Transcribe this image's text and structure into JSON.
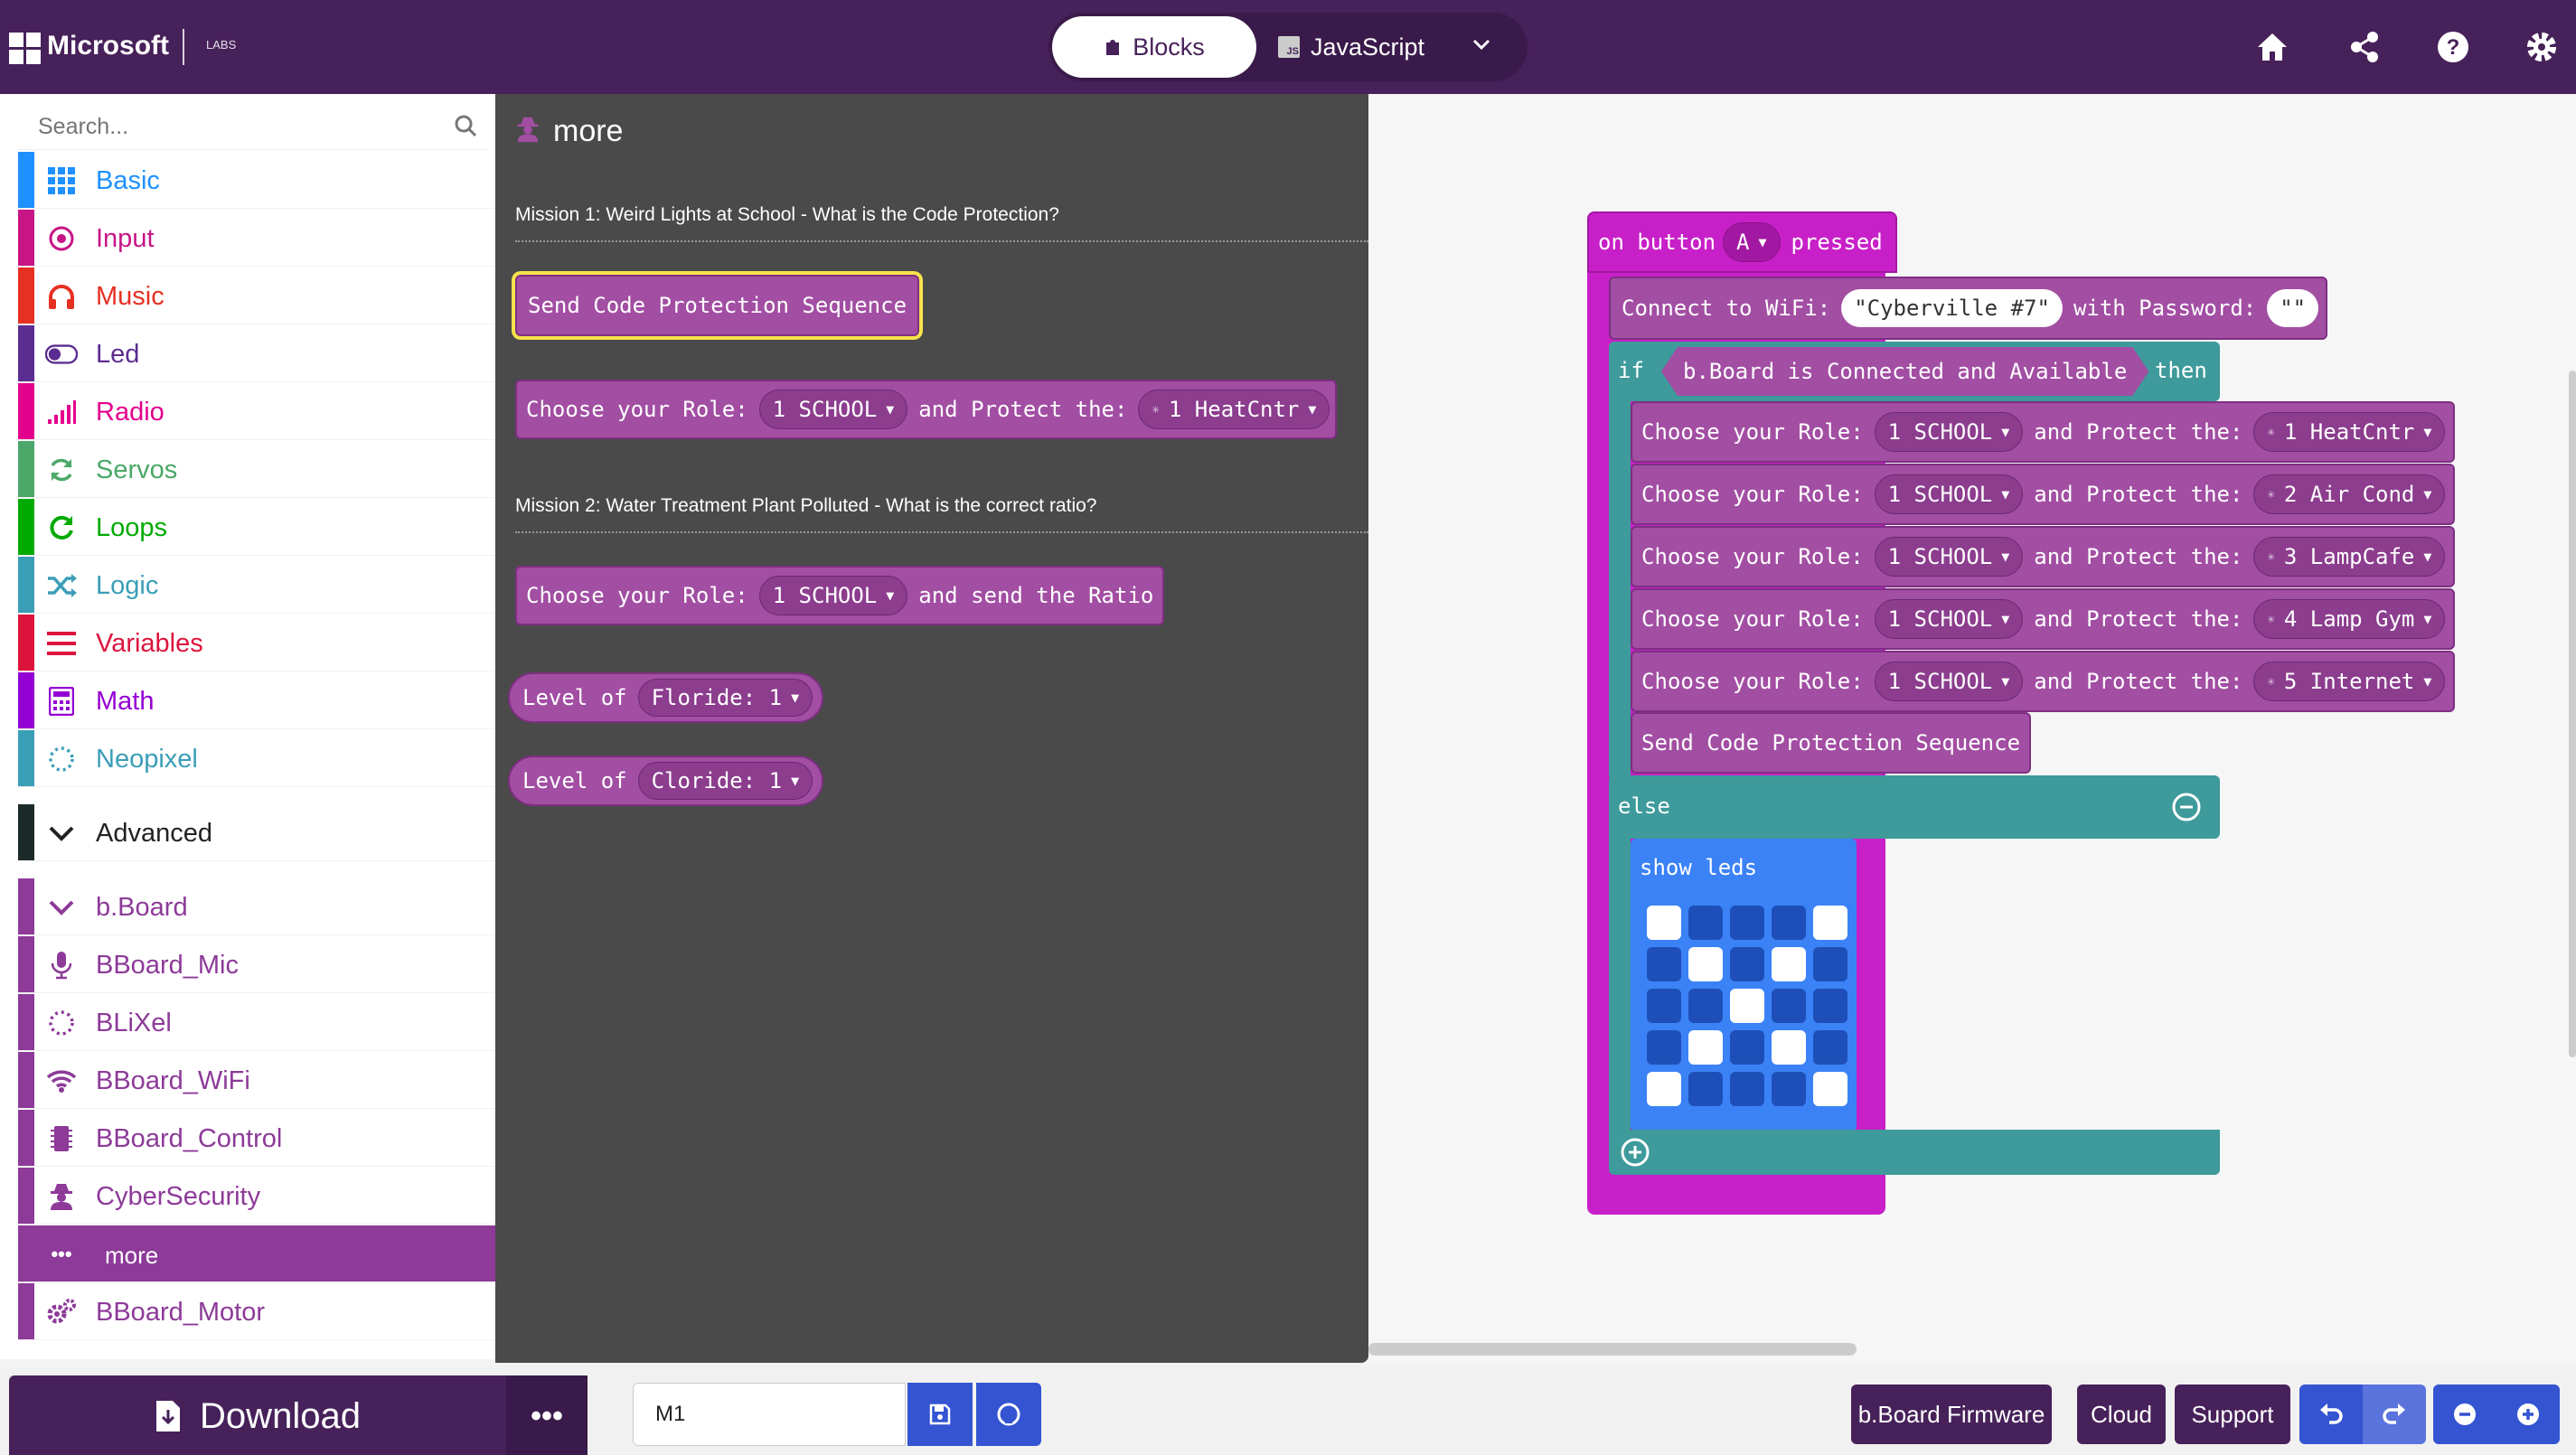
{
  "header": {
    "brand": "Microsoft",
    "secondary_logo": "LABS",
    "tabs": [
      {
        "label": "Blocks"
      },
      {
        "label": "JavaScript"
      }
    ],
    "icons": [
      "home-icon",
      "share-icon",
      "help-icon",
      "settings-icon"
    ]
  },
  "toolbox": {
    "search_placeholder": "Search...",
    "categories": [
      {
        "label": "Basic",
        "color": "#1e90ff",
        "icon": "grid-icon"
      },
      {
        "label": "Input",
        "color": "#c71585",
        "icon": "target-icon"
      },
      {
        "label": "Music",
        "color": "#e63022",
        "icon": "headphones-icon"
      },
      {
        "label": "Led",
        "color": "#5c2d91",
        "icon": "toggle-icon"
      },
      {
        "label": "Radio",
        "color": "#e3008c",
        "icon": "signal-icon"
      },
      {
        "label": "Servos",
        "color": "#4ba868",
        "icon": "refresh-icon"
      },
      {
        "label": "Loops",
        "color": "#00aa00",
        "icon": "loop-icon"
      },
      {
        "label": "Logic",
        "color": "#3b9eb7",
        "icon": "shuffle-icon"
      },
      {
        "label": "Variables",
        "color": "#dc143c",
        "icon": "list-icon"
      },
      {
        "label": "Math",
        "color": "#9400d3",
        "icon": "calculator-icon"
      },
      {
        "label": "Neopixel",
        "color": "#3b9eb7",
        "icon": "dotted-circle-icon"
      }
    ],
    "advanced": "Advanced",
    "extensions": [
      {
        "label": "b.Board",
        "icon": "chevron-down-icon"
      },
      {
        "label": "BBoard_Mic",
        "icon": "microphone-icon"
      },
      {
        "label": "BLiXel",
        "icon": "dotted-circle-icon"
      },
      {
        "label": "BBoard_WiFi",
        "icon": "wifi-icon"
      },
      {
        "label": "BBoard_Control",
        "icon": "chip-icon"
      },
      {
        "label": "CyberSecurity",
        "icon": "user-secret-icon"
      },
      {
        "label": "more",
        "icon": "ellipsis-icon"
      },
      {
        "label": "BBoard_Motor",
        "icon": "cogs-icon"
      }
    ],
    "extension_color": "#8d3a99"
  },
  "flyout": {
    "title": "more",
    "mission1": "Mission 1: Weird Lights at School - What is the Code Protection?",
    "send_code": "Send Code Protection Sequence",
    "choose_role": "Choose your Role:",
    "role_value": "1 SCHOOL",
    "and_protect": "and Protect the:",
    "protect_value": "1 HeatCntr",
    "mission2": "Mission 2: Water Treatment Plant Polluted - What is the correct ratio?",
    "and_send_ratio": "and send the Ratio",
    "level_of": "Level of",
    "floride": "Floride: 1",
    "cloride": "Cloride: 1"
  },
  "workspace": {
    "on_button": "on button",
    "button_value": "A",
    "pressed": "pressed",
    "connect_wifi": "Connect to WiFi:",
    "ssid": "\"Cyberville #7\"",
    "with_password": "with Password:",
    "password": "\"\"",
    "if": "if",
    "condition": "b.Board is Connected and Available",
    "then": "then",
    "choose_role": "Choose your Role:",
    "and_protect": "and Protect the:",
    "rows": [
      {
        "role": "1 SCHOOL",
        "target": "1 HeatCntr"
      },
      {
        "role": "1 SCHOOL",
        "target": "2 Air Cond"
      },
      {
        "role": "1 SCHOOL",
        "target": "3 LampCafe"
      },
      {
        "role": "1 SCHOOL",
        "target": "4 Lamp Gym"
      },
      {
        "role": "1 SCHOOL",
        "target": "5 Internet"
      }
    ],
    "send_code": "Send Code Protection Sequence",
    "else": "else",
    "show_leds": "show leds",
    "leds": [
      [
        1,
        0,
        0,
        0,
        1
      ],
      [
        0,
        1,
        0,
        1,
        0
      ],
      [
        0,
        0,
        1,
        0,
        0
      ],
      [
        0,
        1,
        0,
        1,
        0
      ],
      [
        1,
        0,
        0,
        0,
        1
      ]
    ]
  },
  "bottombar": {
    "download": "Download",
    "more": "•••",
    "project_name": "M1",
    "buttons": [
      "b.Board Firmware",
      "Cloud",
      "Support"
    ]
  }
}
